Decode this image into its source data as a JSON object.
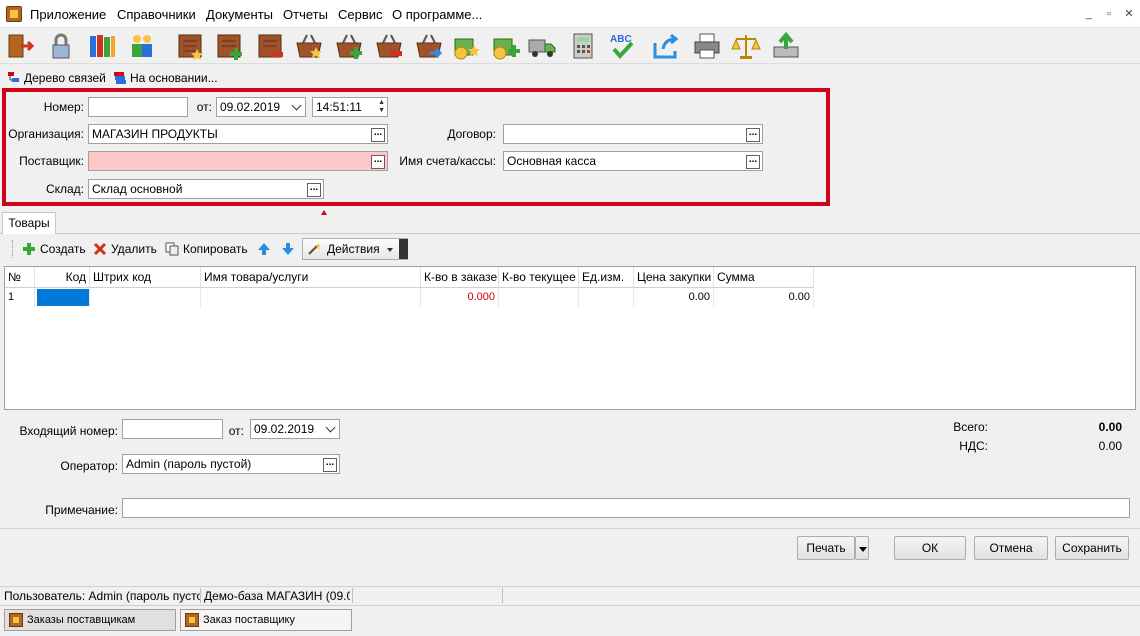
{
  "menu": {
    "items": [
      "Приложение",
      "Справочники",
      "Документы",
      "Отчеты",
      "Сервис",
      "О программе..."
    ]
  },
  "window_controls": {
    "minimize": "_",
    "restore": "▫",
    "close": "✕"
  },
  "toolbar_icons": [
    "exit-icon",
    "lock-icon",
    "books-icon",
    "users-icon",
    "doc-star-icon",
    "doc-add-icon",
    "doc-minus-icon",
    "basket-star-icon",
    "basket-add-icon",
    "basket-minus-icon",
    "basket-arrow-icon",
    "coins-star-icon",
    "coins-add-icon",
    "truck-icon",
    "calculator-icon",
    "spellcheck-icon",
    "export-icon",
    "printer-icon",
    "scales-icon",
    "upload-icon"
  ],
  "subbar": {
    "links_tree": "Дерево связей",
    "on_basis": "На основании..."
  },
  "header": {
    "number_label": "Номер:",
    "number_value": "",
    "from_label": "от:",
    "date_value": "09.02.2019",
    "time_value": "14:51:11",
    "org_label": "Организация:",
    "org_value": "МАГАЗИН ПРОДУКТЫ",
    "supplier_label": "Поставщик:",
    "supplier_value": "",
    "warehouse_label": "Склад:",
    "warehouse_value": "Склад основной",
    "contract_label": "Договор:",
    "contract_value": "",
    "account_label": "Имя счета/кассы:",
    "account_value": "Основная касса",
    "dots": "..."
  },
  "tabs": {
    "goods": "Товары"
  },
  "actions": {
    "create": "Создать",
    "delete": "Удалить",
    "copy": "Копировать",
    "actions": "Действия"
  },
  "grid": {
    "columns": [
      "№",
      "Код",
      "Штрих код",
      "Имя товара/услуги",
      "К-во в заказе",
      "К-во текущее",
      "Ед.изм.",
      "Цена закупки",
      "Сумма"
    ],
    "rows": [
      {
        "num": "1",
        "code": "",
        "barcode": "",
        "name": "",
        "qty_order": "0.000",
        "qty_current": "",
        "unit": "",
        "price": "0.00",
        "sum": "0.00"
      }
    ]
  },
  "footer": {
    "incoming_label": "Входящий номер:",
    "incoming_value": "",
    "from_label": "от:",
    "incoming_date": "09.02.2019",
    "operator_label": "Оператор:",
    "operator_value": "Admin (пароль пустой)",
    "note_label": "Примечание:",
    "note_value": "",
    "total_label": "Всего:",
    "total_value": "0.00",
    "vat_label": "НДС:",
    "vat_value": "0.00",
    "dots": "..."
  },
  "buttons": {
    "print": "Печать",
    "ok": "ОК",
    "cancel": "Отмена",
    "save": "Сохранить"
  },
  "status": {
    "user": "Пользователь: Admin (пароль пусто",
    "db": "Демо-база МАГАЗИН (09.0"
  },
  "taskbar": {
    "tab1": "Заказы поставщикам",
    "tab2": "Заказ поставщику"
  },
  "colors": {
    "highlight_border": "#d0021b",
    "required_field": "#ffc8c8",
    "negative_qty": "#cc0000",
    "selected_cell": "#0078d7"
  }
}
